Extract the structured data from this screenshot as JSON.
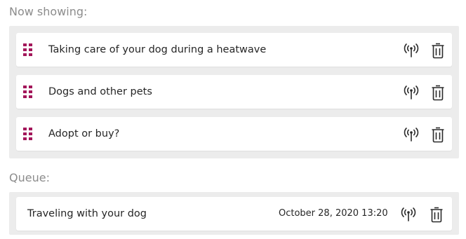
{
  "now_showing": {
    "label": "Now showing:",
    "items": [
      {
        "title": "Taking care of your dog during a heatwave"
      },
      {
        "title": "Dogs and other pets"
      },
      {
        "title": "Adopt or buy?"
      }
    ]
  },
  "queue": {
    "label": "Queue:",
    "items": [
      {
        "title": "Traveling with your dog",
        "scheduled": "October 28, 2020 13:20"
      }
    ]
  },
  "icons": {
    "drag": "drag-handle-icon",
    "broadcast": "broadcast-icon",
    "delete": "trash-icon"
  },
  "colors": {
    "accent": "#a3175a",
    "panel_bg": "#ececec",
    "label": "#8c8c8c"
  }
}
